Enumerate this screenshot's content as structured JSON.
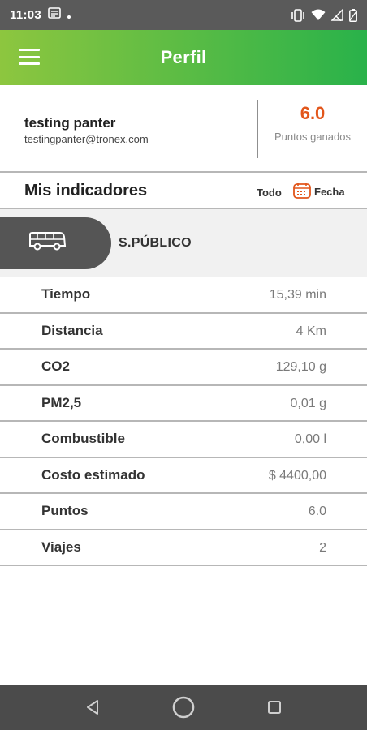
{
  "status_bar": {
    "time": "11:03",
    "icons": [
      "notification-icon",
      "dot-icon",
      "vibrate-icon",
      "wifi-icon",
      "signal-icon",
      "battery-icon"
    ]
  },
  "app_bar": {
    "title": "Perfil",
    "menu_icon": "hamburger-menu-icon",
    "color_start": "#8dc63f",
    "color_end": "#29b24a"
  },
  "profile": {
    "name": "testing panter",
    "email": "testingpanter@tronex.com",
    "points": "6.0",
    "points_label": "Puntos ganados",
    "points_color": "#e2561b"
  },
  "indicators": {
    "title": "Mis indicadores",
    "filter_all": "Todo",
    "filter_date": "Fecha",
    "calendar_icon": "calendar-icon"
  },
  "transport": {
    "mode": "S.PÚBLICO",
    "icon": "bus-icon"
  },
  "metrics": [
    {
      "label": "Tiempo",
      "value": "15,39 min"
    },
    {
      "label": "Distancia",
      "value": "4 Km"
    },
    {
      "label": "CO2",
      "value": "129,10 g"
    },
    {
      "label": "PM2,5",
      "value": "0,01 g"
    },
    {
      "label": "Combustible",
      "value": "0,00 l"
    },
    {
      "label": "Costo estimado",
      "value": "$ 4400,00"
    },
    {
      "label": "Puntos",
      "value": "6.0"
    },
    {
      "label": "Viajes",
      "value": "2"
    }
  ],
  "nav_bar": {
    "icons": [
      "back-icon",
      "home-icon",
      "recents-icon"
    ]
  }
}
